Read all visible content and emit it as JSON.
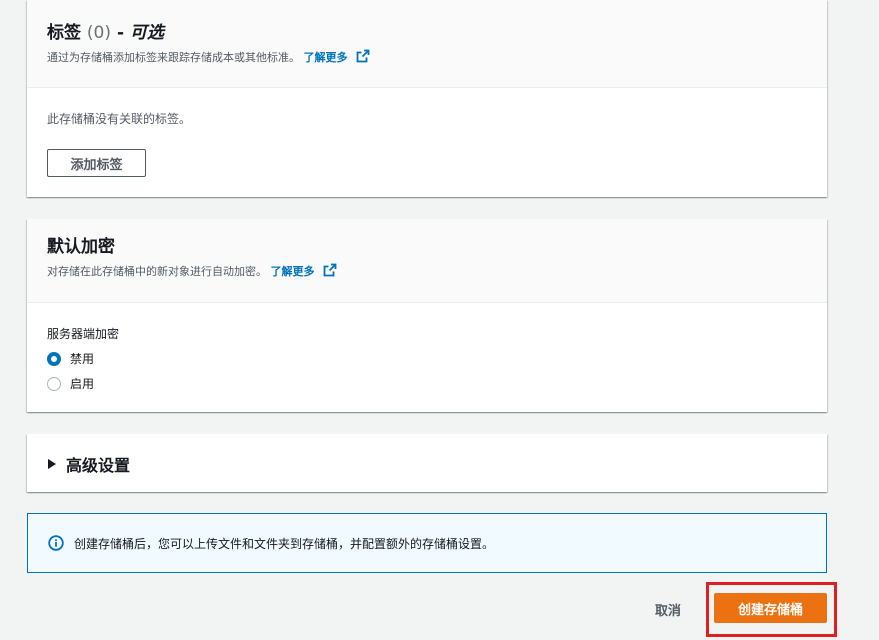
{
  "tags": {
    "title": "标签",
    "count": "(0)",
    "dash": "-",
    "optional": "可选",
    "description": "通过为存储桶添加标签来跟踪存储成本或其他标准。",
    "learn_more": "了解更多",
    "empty_text": "此存储桶没有关联的标签。",
    "add_button": "添加标签"
  },
  "encryption": {
    "title": "默认加密",
    "description": "对存储在此存储桶中的新对象进行自动加密。",
    "learn_more": "了解更多",
    "field_label": "服务器端加密",
    "options": [
      {
        "label": "禁用",
        "selected": true
      },
      {
        "label": "启用",
        "selected": false
      }
    ]
  },
  "advanced": {
    "title": "高级设置"
  },
  "alert": {
    "text": "创建存储桶后，您可以上传文件和文件夹到存储桶，并配置额外的存储桶设置。"
  },
  "actions": {
    "cancel": "取消",
    "create": "创建存储桶"
  },
  "colors": {
    "primary": "#ec7211",
    "link": "#0073bb",
    "highlight": "#e0201e"
  }
}
